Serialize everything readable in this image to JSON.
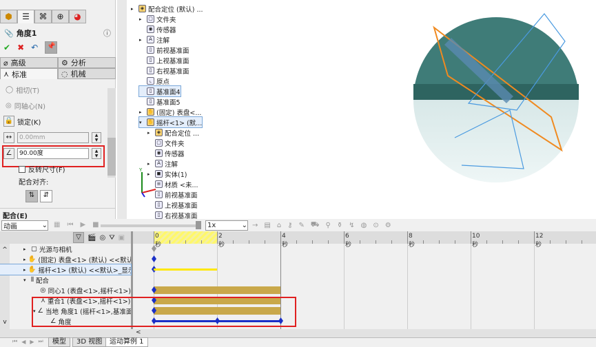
{
  "property_manager": {
    "title": "角度1",
    "tabs": [
      "feature-manager",
      "property-manager",
      "configuration-manager",
      "dimxpert",
      "display-manager"
    ],
    "section_tabs": {
      "advanced": "高级",
      "analysis": "分析",
      "standard": "标准",
      "mechanical": "机械"
    },
    "mate_options": {
      "tangent": "相切(T)",
      "concentric": "同轴心(N)",
      "lock": "锁定(K)"
    },
    "distance_value": "0.00mm",
    "angle_value": "90.00度",
    "flip_dimension": "反转尺寸(F)",
    "mate_alignment": "配合对齐:",
    "mates_section": "配合(E)",
    "highlight_color": "#e02020"
  },
  "feature_tree": [
    "配合定位 (默认) ...",
    "文件夹",
    "传感器",
    "注解",
    "前视基准面",
    "上视基准面",
    "右视基准面",
    "原点",
    "基准面4",
    "基准面5",
    "(固定) 表盘<...",
    "摇杆<1> (默...",
    "配合定位 ...",
    "文件夹",
    "传感器",
    "注解",
    "实体(1)",
    "材质 <未...",
    "前视基准面",
    "上视基准面",
    "右视基准面"
  ],
  "animation": {
    "study_type": "动画",
    "speed": "1x",
    "time_labels": [
      "0 秒",
      "2 秒",
      "4 秒",
      "6 秒",
      "8 秒",
      "10 秒",
      "12 秒"
    ],
    "rows": [
      "光源与相机",
      "(固定) 表盘<1> (默认) <<默认",
      "摇杆<1> (默认) <<默认>_显示",
      "配合",
      "同心1 (表盘<1>,摇杆<1>)",
      "重合1 (表盘<1>,摇杆<1>)",
      "当地 角度1 (摇杆<1>,基准面",
      "角度"
    ],
    "keyframes_sec": [
      0,
      2,
      4
    ],
    "duration_sec": 4,
    "bar_color": "#c9a84a",
    "key_color": "#1a2fc7"
  },
  "bottom_tabs": [
    "模型",
    "3D 视图",
    "运动算例 1"
  ]
}
